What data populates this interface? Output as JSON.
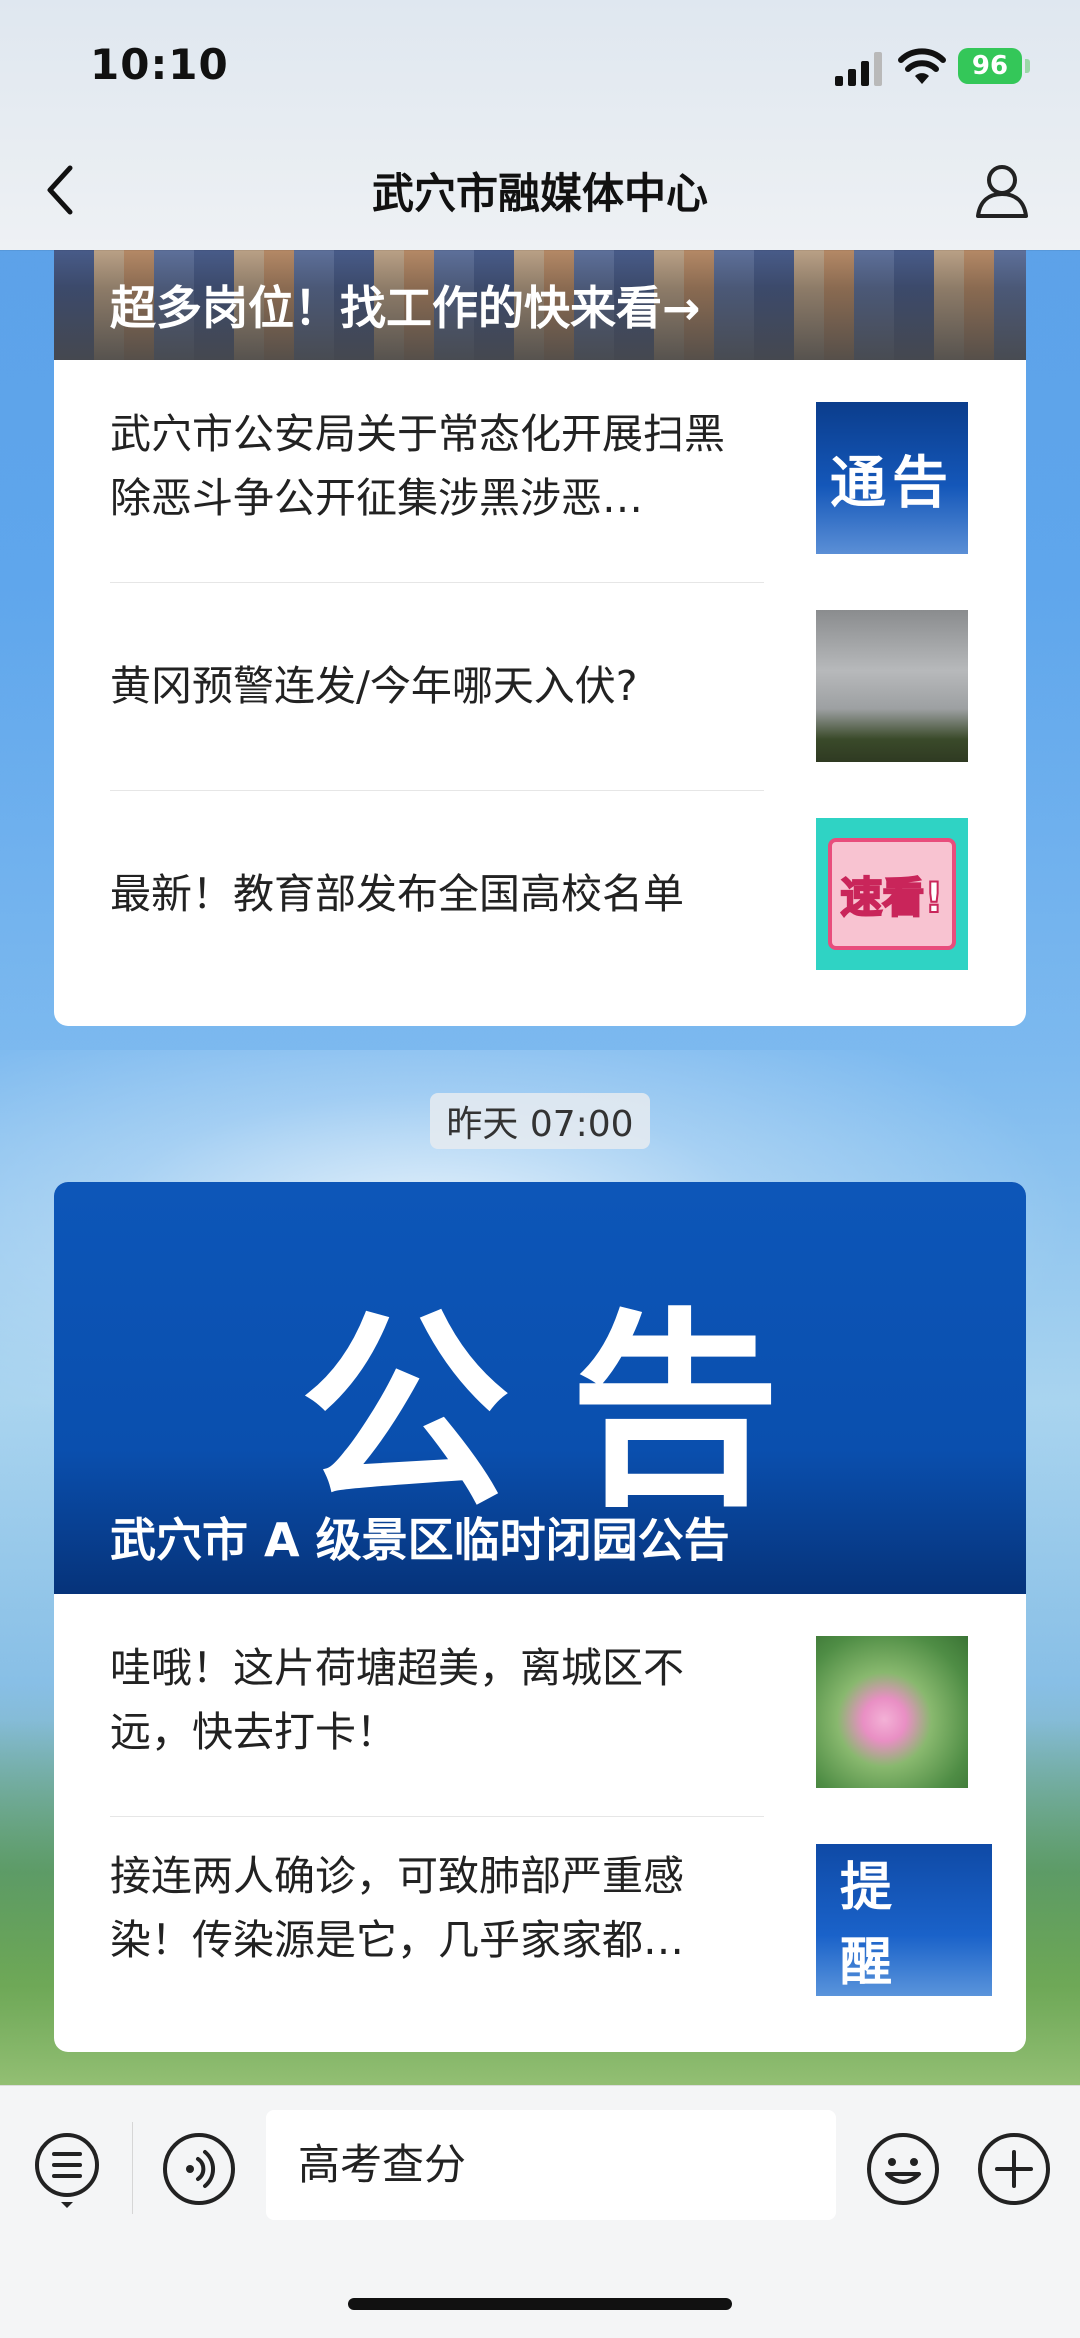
{
  "status_bar": {
    "time": "10:10",
    "battery": "96"
  },
  "nav": {
    "title": "武穴市融媒体中心"
  },
  "feed": {
    "card1": {
      "banner_title": "超多岗位！找工作的快来看→",
      "articles": [
        {
          "title": "武穴市公安局关于常态化开展扫黑除恶斗争公开征集涉黑涉恶…",
          "thumb_text": "通告"
        },
        {
          "title": "黄冈预警连发/今年哪天入伏?",
          "thumb_text": ""
        },
        {
          "title": "最新！教育部发布全国高校名单",
          "thumb_text": "速看!"
        }
      ]
    },
    "timestamp": "昨天 07:00",
    "card2": {
      "banner_big": "公告",
      "banner_title": "武穴市 A 级景区临时闭园公告",
      "articles": [
        {
          "title": "哇哦！这片荷塘超美，离城区不远，快去打卡！",
          "thumb_text": ""
        },
        {
          "title": "接连两人确诊，可致肺部严重感染！传染源是它，几乎家家都…",
          "thumb_text": "提 醒"
        }
      ]
    }
  },
  "input_bar": {
    "text": "高考查分"
  }
}
